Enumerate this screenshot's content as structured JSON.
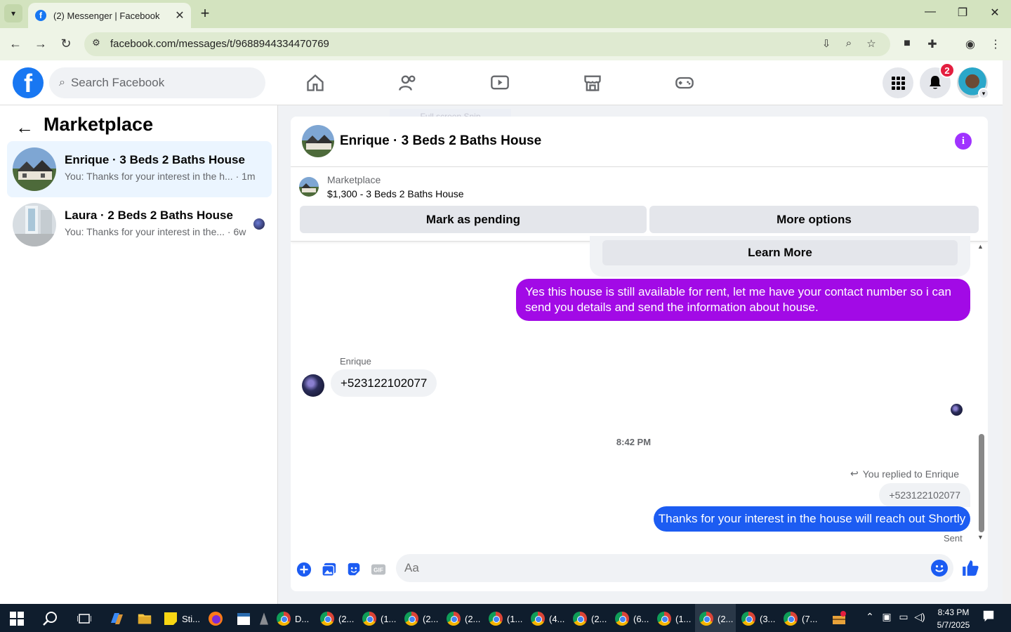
{
  "browser": {
    "tab_title": "(2) Messenger | Facebook",
    "tab_favicon": "f",
    "url": "facebook.com/messages/t/9688944334470769",
    "fullscreen_tip": "Full screen Snip"
  },
  "header": {
    "search_placeholder": "Search Facebook",
    "notification_count": "2",
    "logo": "f"
  },
  "sidebar": {
    "title": "Marketplace",
    "conversations": [
      {
        "name": "Enrique · 3 Beds 2 Baths House",
        "preview": "You: Thanks for your interest in the h... · 1m",
        "active": true
      },
      {
        "name": "Laura · 2 Beds 2 Baths House",
        "preview": "You: Thanks for your interest in the... · 6w",
        "active": false
      }
    ]
  },
  "chat": {
    "title": "Enrique · 3 Beds 2 Baths House",
    "marketplace_label": "Marketplace",
    "listing": "$1,300 - 3 Beds 2 Baths House",
    "mark_pending": "Mark as pending",
    "more_options": "More options",
    "learn_more": "Learn More",
    "messages": {
      "outgoing_1": "Yes this house is still available for rent, let me have your contact number so i can send you details and send the information about house.",
      "sender_name": "Enrique",
      "incoming_1": "+523122102077",
      "timestamp": "8:42 PM",
      "replied_to": "You replied to Enrique",
      "quoted": "+523122102077",
      "outgoing_2": "Thanks for your interest in the house will reach out Shortly",
      "status": "Sent"
    },
    "composer_placeholder": "Aa"
  },
  "taskbar": {
    "items": [
      "D...",
      "(2...",
      "(1...",
      "(2...",
      "(2...",
      "(1...",
      "(4...",
      "(2...",
      "(6...",
      "(1...",
      "(2...",
      "(3...",
      "(7..."
    ],
    "sticky_label": "Sti...",
    "time": "8:43 PM",
    "date": "5/7/2025"
  },
  "colors": {
    "fb_blue": "#1877f2",
    "purple_bubble": "#a20ae6",
    "blue_bubble": "#1c5cf2",
    "active_conv": "#ebf5ff"
  }
}
